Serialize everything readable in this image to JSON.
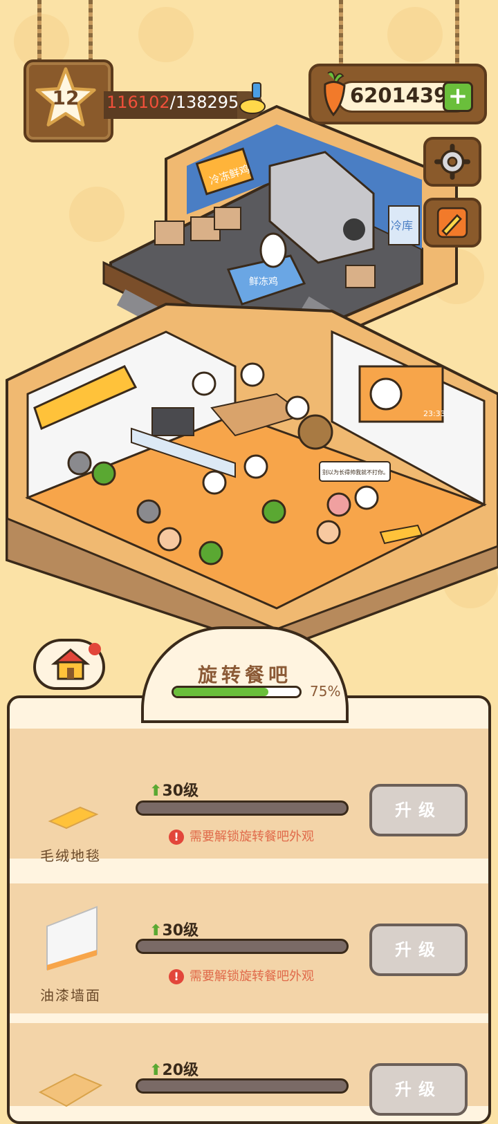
{
  "hud": {
    "level": "12",
    "xp_current": "116102",
    "xp_sep_total": "/138295",
    "carrots": "6201439",
    "plus_label": "+"
  },
  "scene": {
    "sign_cold_storage": "冷冻鲜鸡",
    "sign_freezer": "冷库",
    "counter_label": "鲜冻鸡",
    "speech": "别以为长得帅我就不打你。",
    "clock": "23:33"
  },
  "panel": {
    "title": "旋转餐吧",
    "progress_value": 0.75,
    "progress_text": "75%",
    "items": [
      {
        "name": "毛绒地毯",
        "level": "30级",
        "lock_msg": "需要解锁旋转餐吧外观",
        "button": "升级"
      },
      {
        "name": "油漆墙面",
        "level": "30级",
        "lock_msg": "需要解锁旋转餐吧外观",
        "button": "升级"
      },
      {
        "name": "",
        "level": "20级",
        "lock_msg": "",
        "button": "升级"
      }
    ]
  },
  "colors": {
    "background": "#fbe2a6",
    "wood": "#8a5a2b",
    "accent_green": "#6abf3b",
    "warning": "#e2463a",
    "panel": "#fff4e0"
  }
}
